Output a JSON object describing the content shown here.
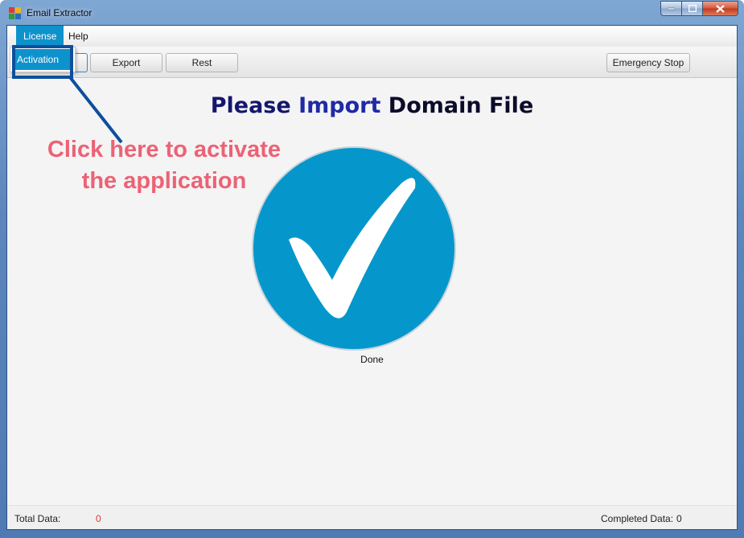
{
  "window": {
    "title": "Email Extractor"
  },
  "menu": {
    "items": [
      {
        "label": "License",
        "active": true
      },
      {
        "label": "Help",
        "active": false
      }
    ]
  },
  "dropdown": {
    "items": [
      "Activation"
    ]
  },
  "toolbar": {
    "export_label": "Export",
    "rest_label": "Rest",
    "emergency_label": "Emergency Stop"
  },
  "main": {
    "headline_parts": [
      "Please",
      "Import",
      "Domain File"
    ],
    "status_label": "Done"
  },
  "annotation": {
    "line1": "Click here to activate",
    "line2": "the application"
  },
  "status": {
    "total_label": "Total Data:",
    "total_value": "0",
    "completed_label": "Completed Data:",
    "completed_value": "0"
  },
  "colors": {
    "accent": "#0e92cc",
    "check_circle": "#0597cc",
    "callout": "#ec6275",
    "highlight": "#0d4f9c",
    "total_value": "#e53333"
  },
  "icons": {
    "check": "checkmark-circle-icon",
    "app": "app-logo-icon"
  }
}
